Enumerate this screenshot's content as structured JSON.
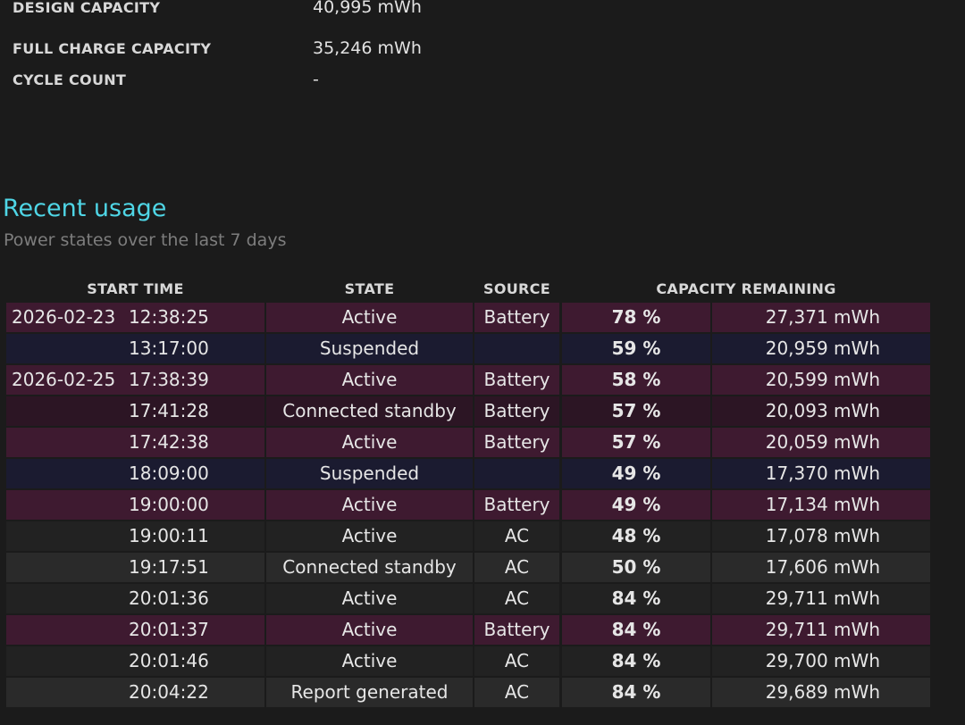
{
  "battery_info": {
    "design_capacity_label": "DESIGN CAPACITY",
    "design_capacity_value": "40,995 mWh",
    "full_charge_label": "FULL CHARGE CAPACITY",
    "full_charge_value": "35,246 mWh",
    "cycle_count_label": "CYCLE COUNT",
    "cycle_count_value": "-"
  },
  "recent_usage": {
    "title": "Recent usage",
    "subtitle": "Power states over the last 7 days",
    "headers": {
      "start_time": "START TIME",
      "state": "STATE",
      "source": "SOURCE",
      "capacity_remaining": "CAPACITY REMAINING"
    },
    "rows": [
      {
        "date": "2026-02-23",
        "time": "12:38:25",
        "state": "Active",
        "source": "Battery",
        "percent": "78 %",
        "mwh": "27,371 mWh"
      },
      {
        "date": "",
        "time": "13:17:00",
        "state": "Suspended",
        "source": "",
        "percent": "59 %",
        "mwh": "20,959 mWh"
      },
      {
        "date": "2026-02-25",
        "time": "17:38:39",
        "state": "Active",
        "source": "Battery",
        "percent": "58 %",
        "mwh": "20,599 mWh"
      },
      {
        "date": "",
        "time": "17:41:28",
        "state": "Connected standby",
        "source": "Battery",
        "percent": "57 %",
        "mwh": "20,093 mWh"
      },
      {
        "date": "",
        "time": "17:42:38",
        "state": "Active",
        "source": "Battery",
        "percent": "57 %",
        "mwh": "20,059 mWh"
      },
      {
        "date": "",
        "time": "18:09:00",
        "state": "Suspended",
        "source": "",
        "percent": "49 %",
        "mwh": "17,370 mWh"
      },
      {
        "date": "",
        "time": "19:00:00",
        "state": "Active",
        "source": "Battery",
        "percent": "49 %",
        "mwh": "17,134 mWh"
      },
      {
        "date": "",
        "time": "19:00:11",
        "state": "Active",
        "source": "AC",
        "percent": "48 %",
        "mwh": "17,078 mWh"
      },
      {
        "date": "",
        "time": "19:17:51",
        "state": "Connected standby",
        "source": "AC",
        "percent": "50 %",
        "mwh": "17,606 mWh"
      },
      {
        "date": "",
        "time": "20:01:36",
        "state": "Active",
        "source": "AC",
        "percent": "84 %",
        "mwh": "29,711 mWh"
      },
      {
        "date": "",
        "time": "20:01:37",
        "state": "Active",
        "source": "Battery",
        "percent": "84 %",
        "mwh": "29,711 mWh"
      },
      {
        "date": "",
        "time": "20:01:46",
        "state": "Active",
        "source": "AC",
        "percent": "84 %",
        "mwh": "29,700 mWh"
      },
      {
        "date": "",
        "time": "20:04:22",
        "state": "Report generated",
        "source": "AC",
        "percent": "84 %",
        "mwh": "29,689 mWh"
      }
    ]
  }
}
